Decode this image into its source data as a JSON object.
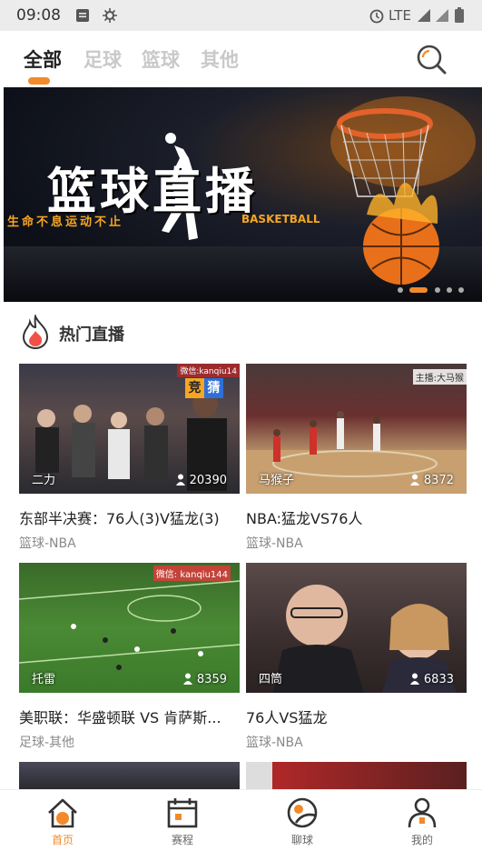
{
  "status_bar": {
    "time": "09:08",
    "network": "LTE"
  },
  "tabs": [
    {
      "label": "全部",
      "active": true
    },
    {
      "label": "足球",
      "active": false
    },
    {
      "label": "篮球",
      "active": false
    },
    {
      "label": "其他",
      "active": false
    }
  ],
  "banner": {
    "title": "篮球直播",
    "slogan": "生命不息运动不止",
    "subtitle": "BASKETBALL",
    "page_count": 5,
    "active_page": 2
  },
  "section": {
    "title": "热门直播"
  },
  "cards": [
    {
      "streamer": "二力",
      "views": "20390",
      "title": "东部半决赛：76人(3)V猛龙(3)",
      "category": "篮球-NBA"
    },
    {
      "streamer": "马猴子",
      "views": "8372",
      "title": "NBA:猛龙VS76人",
      "category": "篮球-NBA"
    },
    {
      "streamer": "托雷",
      "views": "8359",
      "title": "美职联：华盛顿联 VS 肯萨斯...",
      "category": "足球-其他"
    },
    {
      "streamer": "四筒",
      "views": "6833",
      "title": "76人VS猛龙",
      "category": "篮球-NBA"
    }
  ],
  "thumb_overlays": {
    "wechat_1": "微信:kanqiu14",
    "jingcai_1": "竞",
    "jingcai_2": "猜",
    "host_2": "主播:大马猴",
    "wechat_3": "微信: kanqiu144"
  },
  "bottom_nav": [
    {
      "label": "首页",
      "icon": "home-icon",
      "active": true
    },
    {
      "label": "赛程",
      "icon": "calendar-icon",
      "active": false
    },
    {
      "label": "聊球",
      "icon": "chat-ball-icon",
      "active": false
    },
    {
      "label": "我的",
      "icon": "profile-icon",
      "active": false
    }
  ],
  "colors": {
    "accent": "#f28a2c",
    "inactive_tab": "#c9c9c9",
    "category_text": "#8a8a8a"
  }
}
